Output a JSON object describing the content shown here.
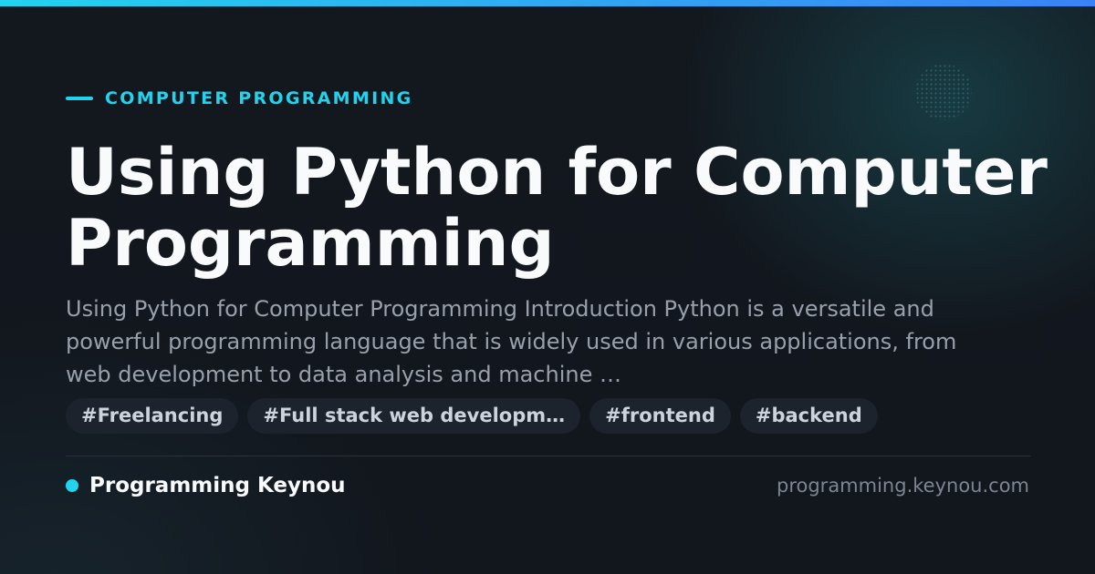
{
  "colors": {
    "accent": "#22d3ee",
    "accent_gradient_end": "#3b82f6",
    "background": "#12161d",
    "title": "#f8fafc",
    "excerpt": "#98a0ab",
    "tag_background": "#1c232d",
    "url": "#7c8591"
  },
  "category": {
    "label": "COMPUTER PROGRAMMING"
  },
  "post": {
    "title": "Using Python for Computer Programming",
    "excerpt": "Using Python for Computer Programming Introduction Python is a versatile and powerful programming language that is widely used in various applications, from web development to data analysis and machine …"
  },
  "tags": [
    "#Freelancing",
    "#Full stack web developm…",
    "#frontend",
    "#backend"
  ],
  "footer": {
    "site_name": "Programming Keynou",
    "site_url": "programming.keynou.com",
    "status_icon": "dot-icon"
  }
}
